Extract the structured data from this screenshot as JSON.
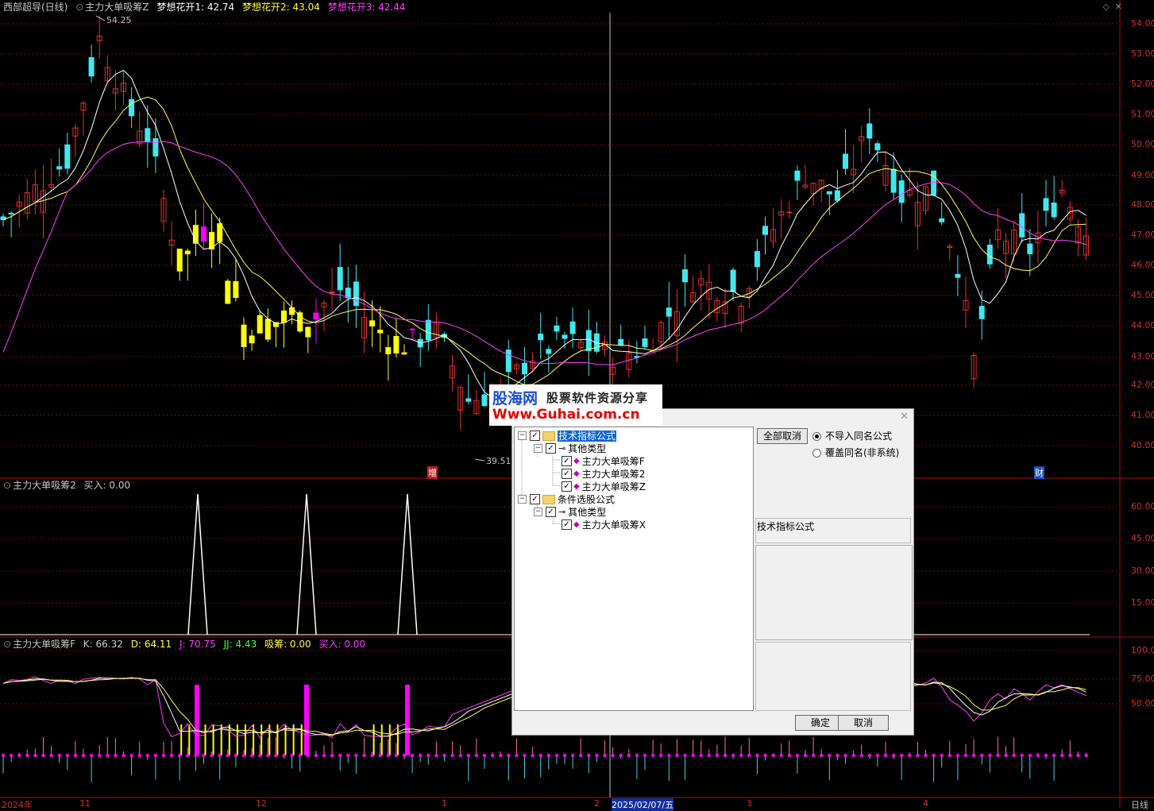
{
  "top_header": {
    "title": "西部超导(日线)",
    "indicator": "主力大单吸筹Z",
    "ma1": "梦想花开1: 42.74",
    "ma2": "梦想花开2: 43.04",
    "ma3": "梦想花开3: 42.44"
  },
  "mid_header": {
    "indicator": "主力大单吸筹2",
    "buy": "买入: 0.00"
  },
  "bottom_header": {
    "indicator": "主力大单吸筹F",
    "k": "K: 66.32",
    "d": "D: 64.11",
    "j": "J: 70.75",
    "jj": "JJ: 4.43",
    "xichou": "吸筹: 0.00",
    "buy": "买入: 0.00"
  },
  "price_axis": [
    "54.00",
    "53.00",
    "52.00",
    "51.00",
    "50.00",
    "49.00",
    "48.00",
    "47.00",
    "46.00",
    "45.00",
    "44.00",
    "43.00",
    "42.00",
    "41.00",
    "40.00"
  ],
  "mid_axis": [
    "60.00",
    "45.00",
    "30.00",
    "15.00"
  ],
  "bottom_axis": [
    "100.0",
    "75.00",
    "50.00"
  ],
  "time_axis": {
    "labels": [
      "2024年",
      "11",
      "12",
      "1",
      "2",
      "2025/02/07/五",
      "3",
      "4"
    ],
    "period": "日线"
  },
  "markers": {
    "high": "54.25",
    "low": "39.51",
    "zeng": "增",
    "cai": "财"
  },
  "watermark": {
    "brand": "股海网",
    "slogan": "股票软件资源分享",
    "url": "Www.Guhai.com.cn"
  },
  "dialog": {
    "close": "✕",
    "tree": [
      {
        "label": "技术指标公式",
        "level": 0,
        "icon": "folder",
        "selected": true
      },
      {
        "label": "其他类型",
        "level": 1,
        "icon": "key"
      },
      {
        "label": "主力大单吸筹F",
        "level": 2,
        "icon": "gem"
      },
      {
        "label": "主力大单吸筹2",
        "level": 2,
        "icon": "gem"
      },
      {
        "label": "主力大单吸筹Z",
        "level": 2,
        "icon": "gem"
      },
      {
        "label": "条件选股公式",
        "level": 0,
        "icon": "folder"
      },
      {
        "label": "其他类型",
        "level": 1,
        "icon": "key"
      },
      {
        "label": "主力大单吸筹X",
        "level": 2,
        "icon": "gem"
      }
    ],
    "cancel_all": "全部取消",
    "option1": "不导入同名公式",
    "option2": "覆盖同名(非系统)",
    "info_label": "技术指标公式",
    "ok": "确定",
    "cancel": "取消"
  },
  "colors": {
    "up": "#e03030",
    "down": "#40e8f0",
    "signal_yellow": "#ffff00",
    "signal_magenta": "#ff00ff",
    "ma_white": "#ffffff",
    "ma_yellow": "#ffff60",
    "ma_magenta": "#ff40ff"
  }
}
